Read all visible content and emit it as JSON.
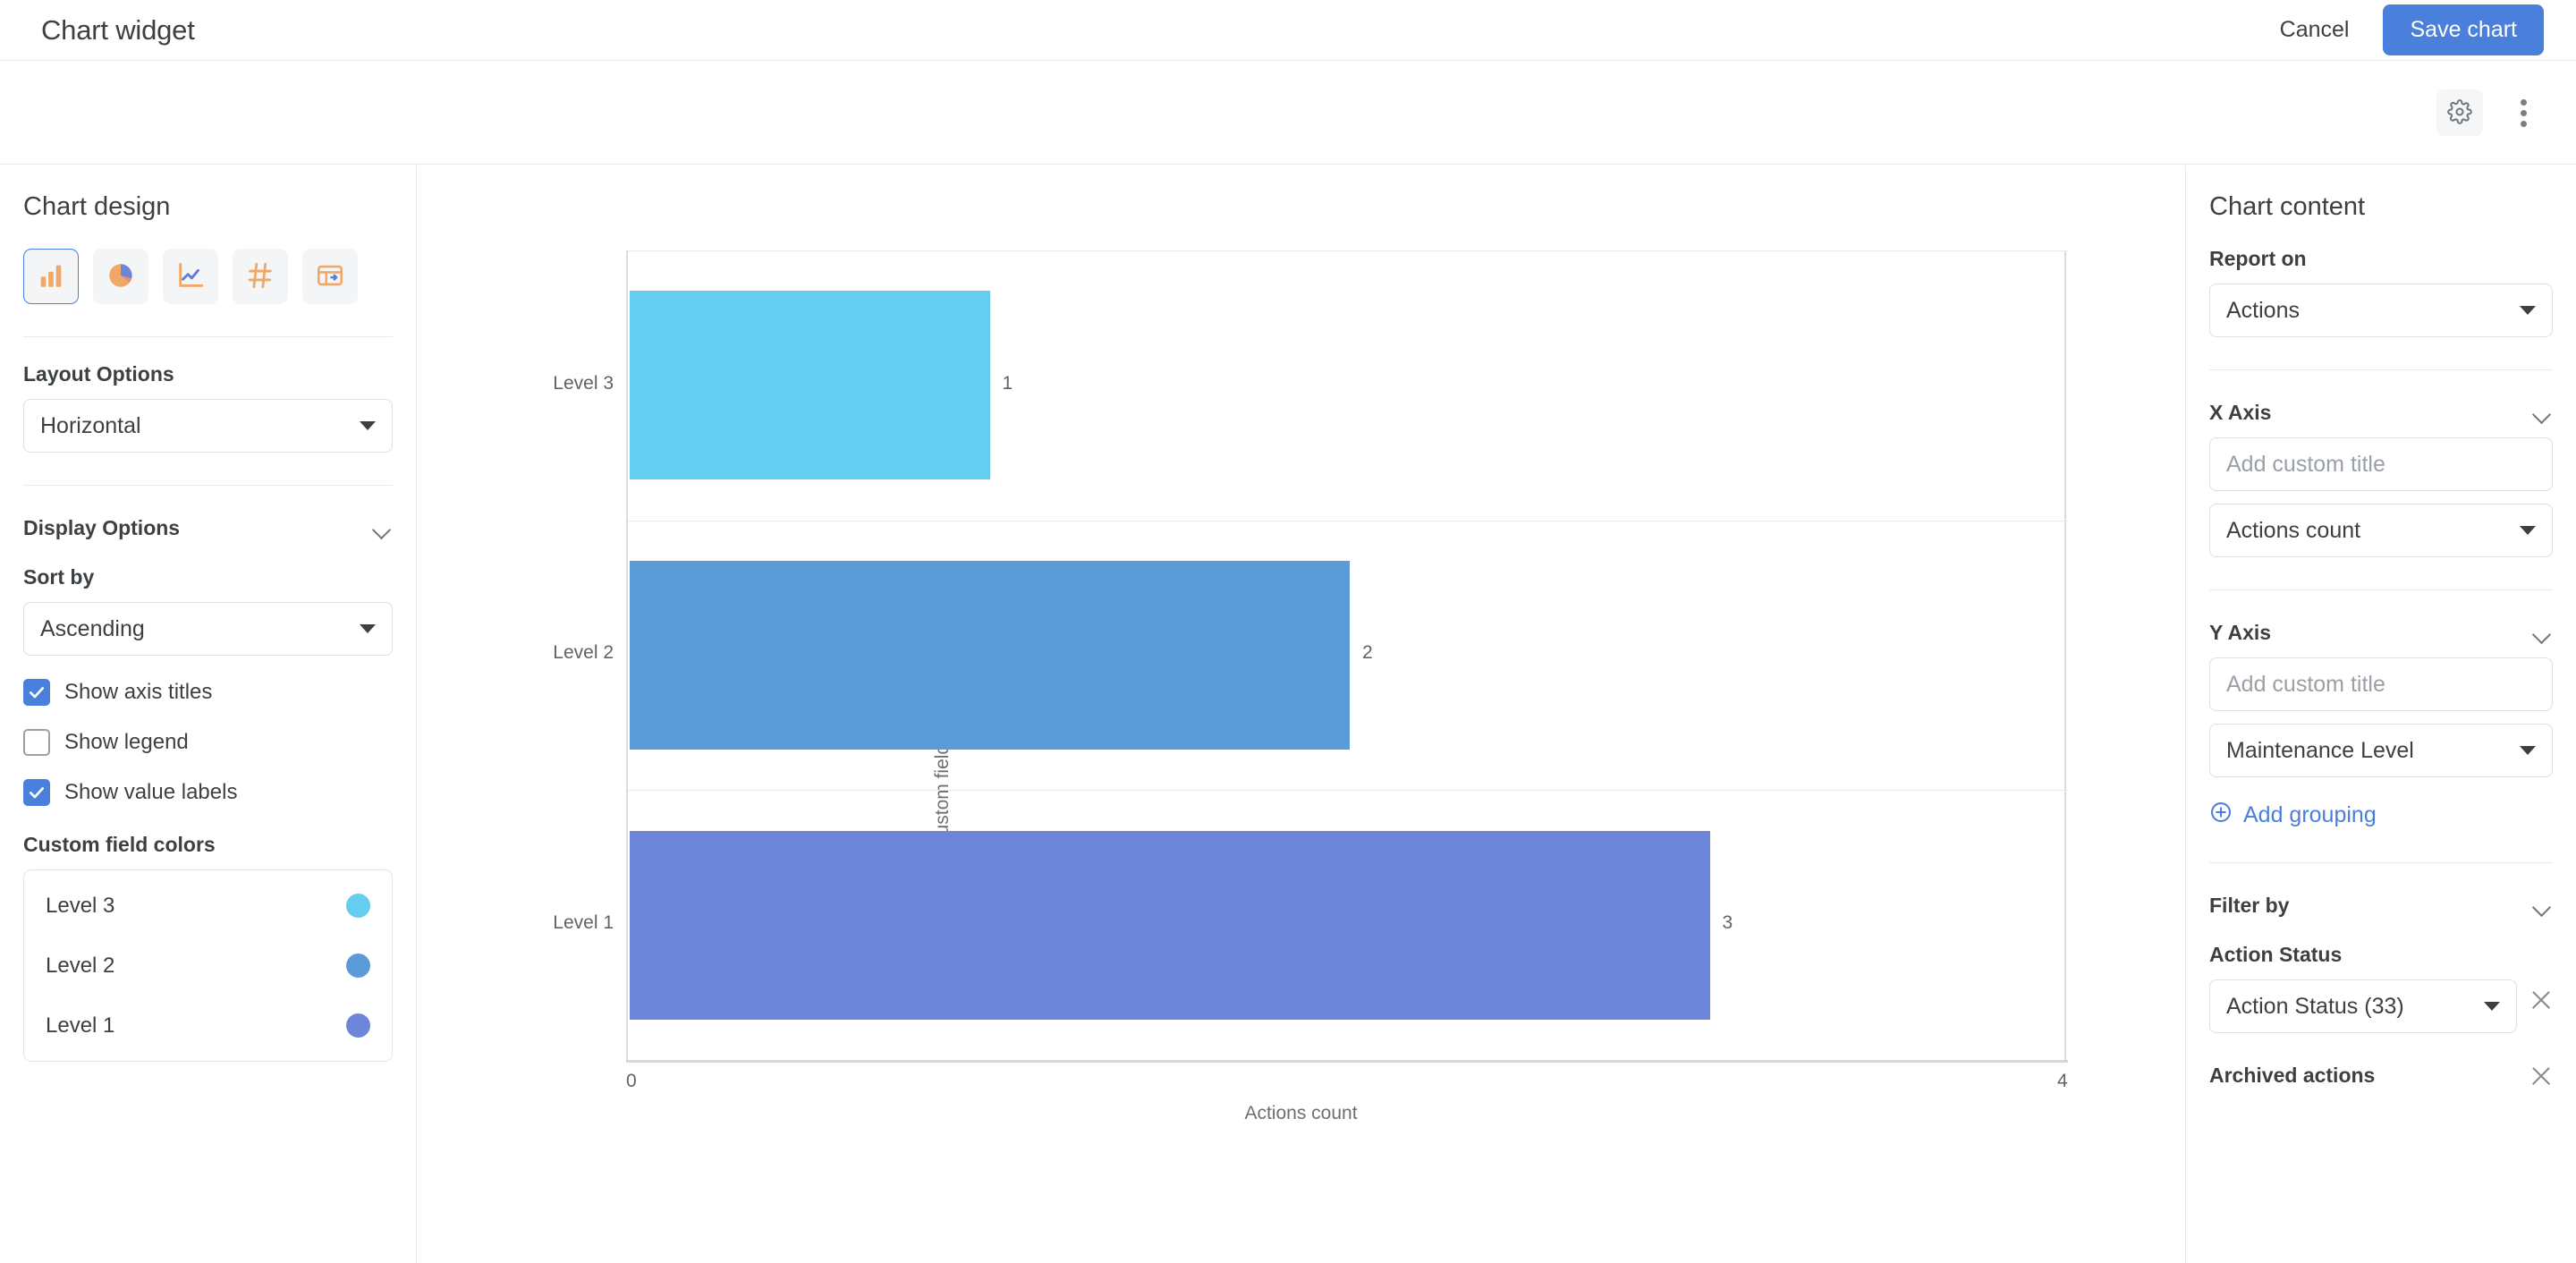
{
  "header": {
    "title": "Chart widget",
    "cancel_label": "Cancel",
    "save_label": "Save chart"
  },
  "toolbar": {
    "gear_icon": "gear-icon",
    "more_icon": "kebab-menu-icon"
  },
  "left_panel": {
    "title": "Chart design",
    "chart_types": [
      {
        "name": "bar-chart-icon",
        "selected": true
      },
      {
        "name": "pie-chart-icon",
        "selected": false
      },
      {
        "name": "line-chart-icon",
        "selected": false
      },
      {
        "name": "number-chart-icon",
        "selected": false
      },
      {
        "name": "table-chart-icon",
        "selected": false
      }
    ],
    "layout_options": {
      "label": "Layout Options",
      "value": "Horizontal"
    },
    "display_options": {
      "label": "Display Options",
      "sort_by_label": "Sort by",
      "sort_by_value": "Ascending",
      "checkboxes": [
        {
          "label": "Show axis titles",
          "checked": true
        },
        {
          "label": "Show legend",
          "checked": false
        },
        {
          "label": "Show value labels",
          "checked": true
        }
      ]
    },
    "custom_field_colors": {
      "label": "Custom field colors",
      "items": [
        {
          "label": "Level 3",
          "color": "#64cdf0"
        },
        {
          "label": "Level 2",
          "color": "#5b9bd8"
        },
        {
          "label": "Level 1",
          "color": "#6d86da"
        }
      ]
    }
  },
  "right_panel": {
    "title": "Chart content",
    "report_on": {
      "label": "Report on",
      "value": "Actions"
    },
    "x_axis": {
      "label": "X Axis",
      "custom_title_placeholder": "Add custom title",
      "custom_title_value": "",
      "field_value": "Actions count"
    },
    "y_axis": {
      "label": "Y Axis",
      "custom_title_placeholder": "Add custom title",
      "custom_title_value": "",
      "field_value": "Maintenance Level",
      "add_grouping_label": "Add grouping"
    },
    "filter_by": {
      "label": "Filter by",
      "action_status_label": "Action Status",
      "action_status_value": "Action Status (33)",
      "archived_actions_label": "Archived actions"
    }
  },
  "chart_data": {
    "type": "bar",
    "orientation": "horizontal",
    "categories": [
      "Level 3",
      "Level 2",
      "Level 1"
    ],
    "values": [
      1,
      2,
      3
    ],
    "colors": [
      "#64cdf0",
      "#5b9bd8",
      "#6d86da"
    ],
    "title": "",
    "xlabel": "Actions count",
    "ylabel": "Custom fields",
    "xlim": [
      0,
      4
    ],
    "xticks": [
      "0",
      "4"
    ],
    "value_labels": [
      "1",
      "2",
      "3"
    ],
    "grid": true,
    "legend": false
  }
}
